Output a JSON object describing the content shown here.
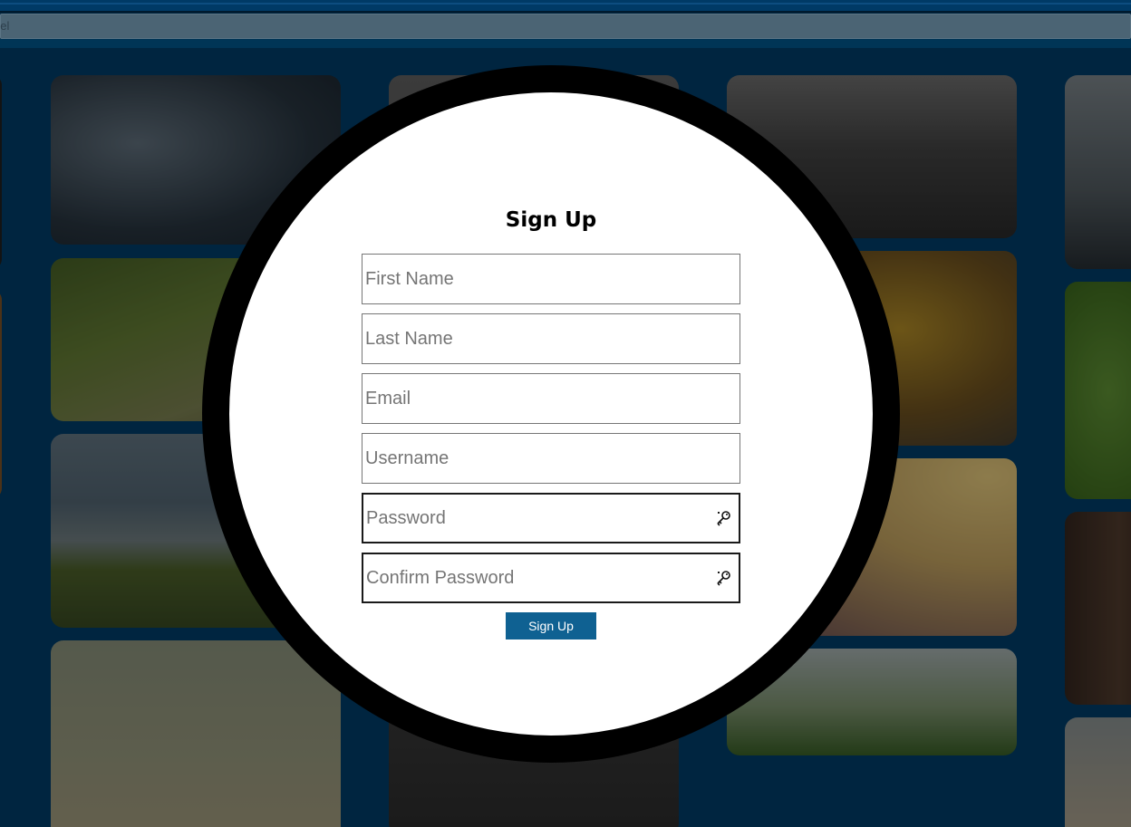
{
  "search": {
    "fragment": "bel"
  },
  "form": {
    "title": "Sign Up",
    "fields": [
      {
        "placeholder": "First Name",
        "value": ""
      },
      {
        "placeholder": "Last Name",
        "value": ""
      },
      {
        "placeholder": "Email",
        "value": ""
      },
      {
        "placeholder": "Username",
        "value": ""
      },
      {
        "placeholder": "Password",
        "value": "",
        "icon": "password-key-icon"
      },
      {
        "placeholder": "Confirm Password",
        "value": "",
        "icon": "password-key-icon"
      }
    ],
    "submit_label": "Sign Up"
  },
  "colors": {
    "page_background": "#002540",
    "button": "#0f6192",
    "ring": "#000000"
  }
}
